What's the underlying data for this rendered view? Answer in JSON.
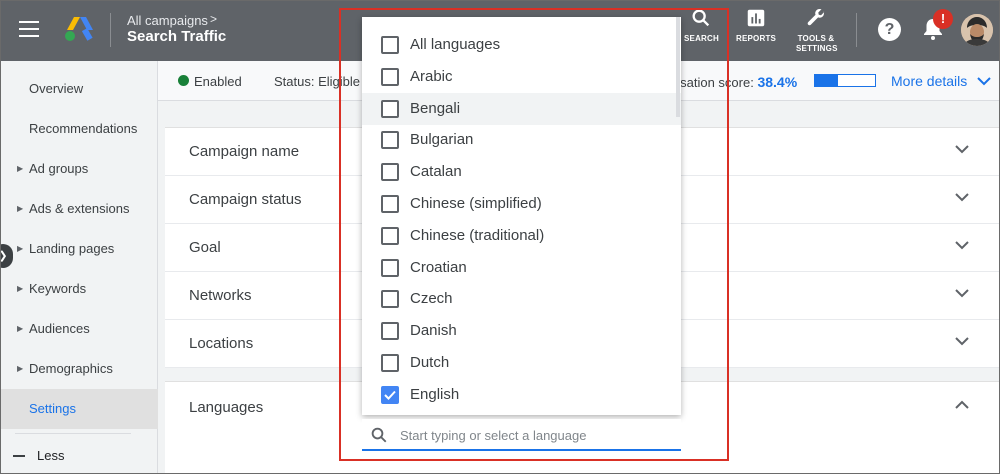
{
  "header": {
    "breadcrumb_parent": "All campaigns",
    "breadcrumb_chevron": ">",
    "campaign_title": "Search Traffic",
    "search_label": "SEARCH",
    "reports_label": "REPORTS",
    "tools_label_1": "TOOLS &",
    "tools_label_2": "SETTINGS",
    "help_glyph": "?",
    "notification_badge": "!"
  },
  "sidebar": {
    "items": [
      {
        "label": "Overview",
        "has_caret": false,
        "active": false
      },
      {
        "label": "Recommendations",
        "has_caret": false,
        "active": false
      },
      {
        "label": "Ad groups",
        "has_caret": true,
        "active": false
      },
      {
        "label": "Ads & extensions",
        "has_caret": true,
        "active": false
      },
      {
        "label": "Landing pages",
        "has_caret": true,
        "active": false
      },
      {
        "label": "Keywords",
        "has_caret": true,
        "active": false
      },
      {
        "label": "Audiences",
        "has_caret": true,
        "active": false
      },
      {
        "label": "Demographics",
        "has_caret": true,
        "active": false
      },
      {
        "label": "Settings",
        "has_caret": false,
        "active": true
      }
    ],
    "less_label": "Less"
  },
  "status_bar": {
    "enabled_label": "Enabled",
    "status_label": "Status: Eligible",
    "optimisation_label": "nisation score:",
    "optimisation_score": "38.4%",
    "optimisation_fraction": 0.384,
    "more_details": "More details"
  },
  "settings": {
    "rows": [
      "Campaign name",
      "Campaign status",
      "Goal",
      "Networks",
      "Locations"
    ],
    "languages_label": "Languages"
  },
  "language_dropdown": {
    "options": [
      {
        "label": "All languages",
        "checked": false,
        "hover": false
      },
      {
        "label": "Arabic",
        "checked": false,
        "hover": false
      },
      {
        "label": "Bengali",
        "checked": false,
        "hover": true
      },
      {
        "label": "Bulgarian",
        "checked": false,
        "hover": false
      },
      {
        "label": "Catalan",
        "checked": false,
        "hover": false
      },
      {
        "label": "Chinese (simplified)",
        "checked": false,
        "hover": false
      },
      {
        "label": "Chinese (traditional)",
        "checked": false,
        "hover": false
      },
      {
        "label": "Croatian",
        "checked": false,
        "hover": false
      },
      {
        "label": "Czech",
        "checked": false,
        "hover": false
      },
      {
        "label": "Danish",
        "checked": false,
        "hover": false
      },
      {
        "label": "Dutch",
        "checked": false,
        "hover": false
      },
      {
        "label": "English",
        "checked": true,
        "hover": false
      }
    ],
    "search_placeholder": "Start typing or select a language",
    "search_value": ""
  },
  "colors": {
    "accent": "#1a73e8",
    "checkbox_checked": "#4285f4",
    "highlight_box": "#d93025",
    "enabled_dot": "#188038",
    "topbar": "#5f6368"
  }
}
